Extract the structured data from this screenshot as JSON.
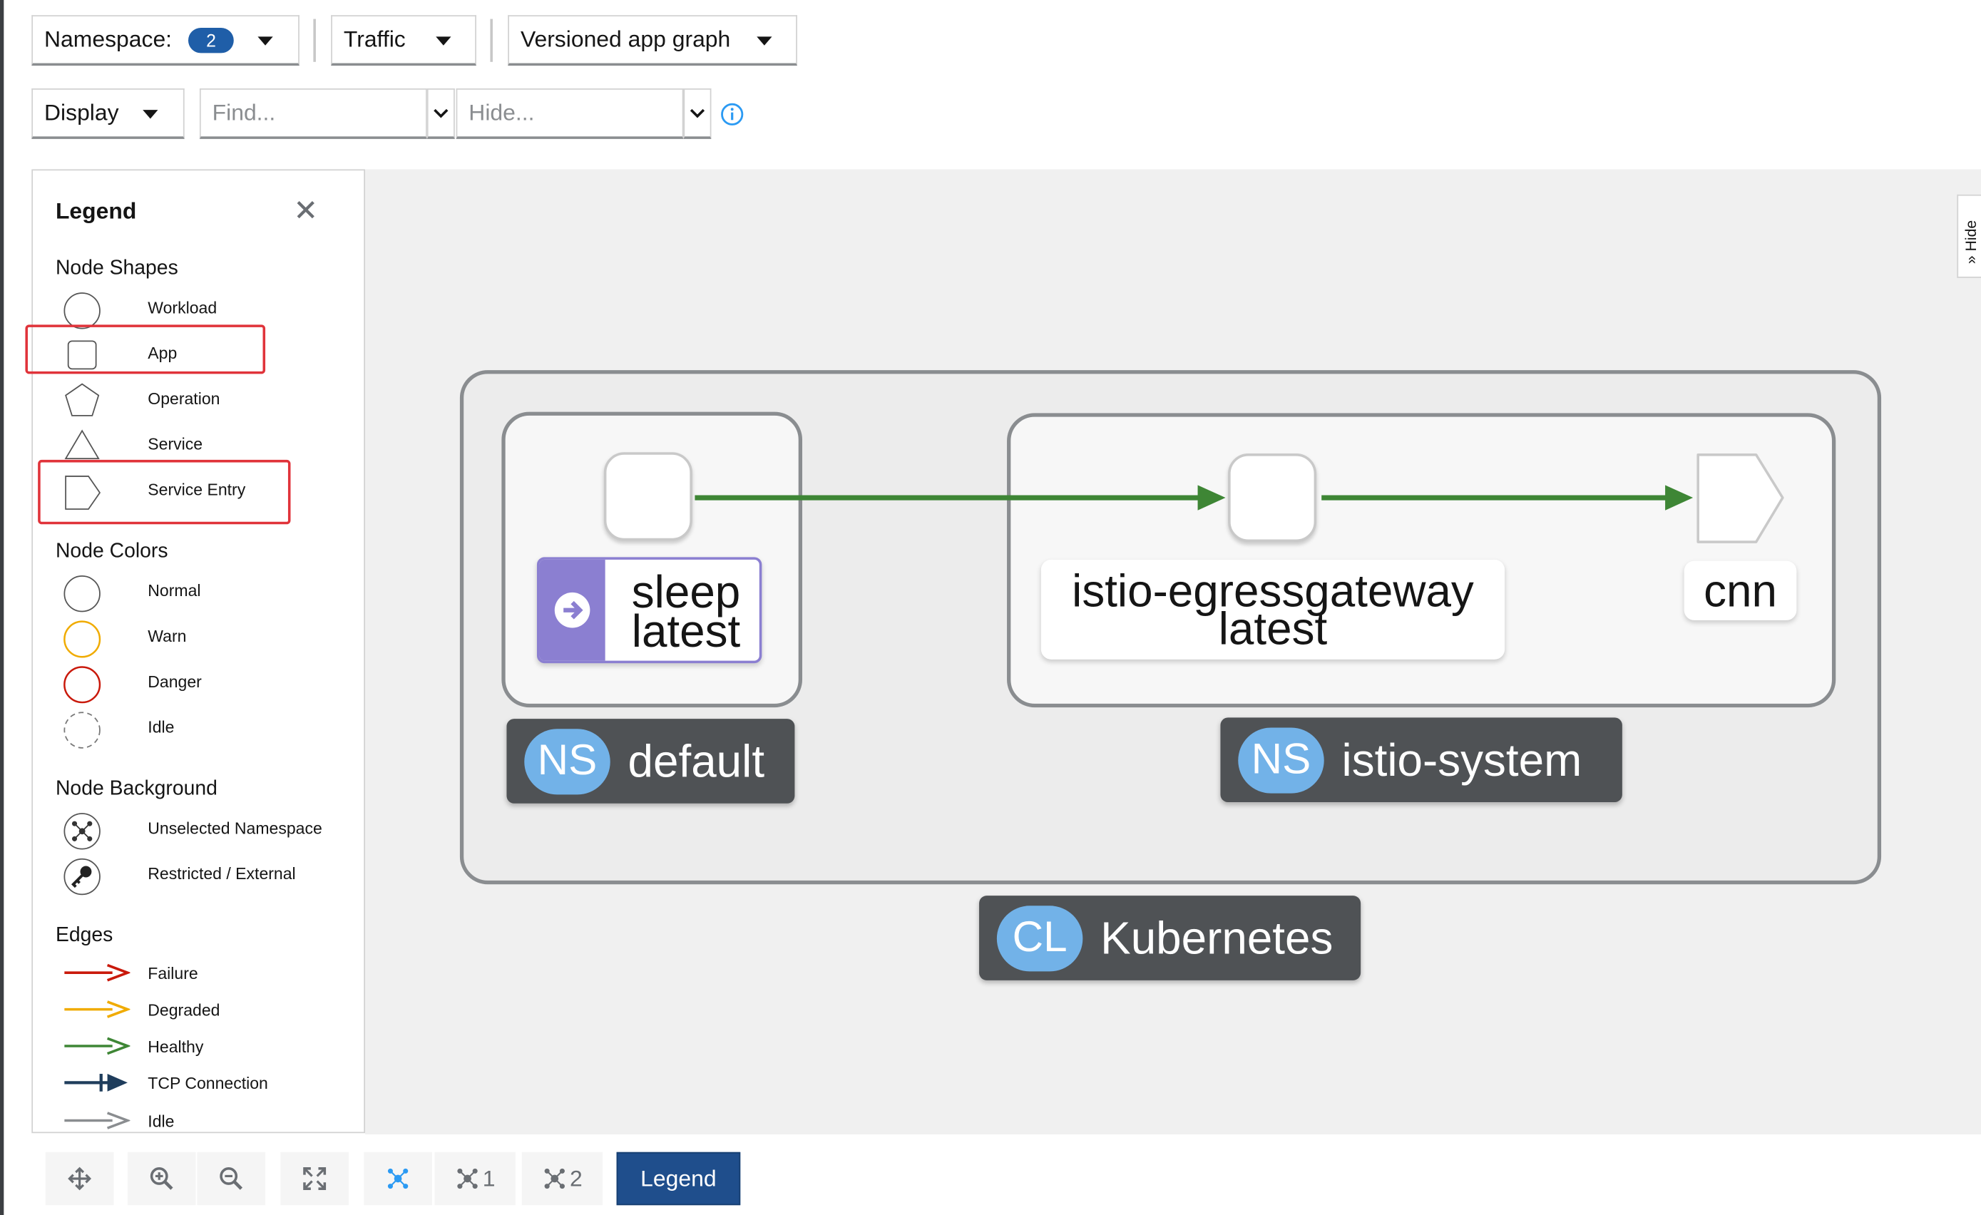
{
  "toolbar": {
    "namespace_label": "Namespace:",
    "namespace_count": "2",
    "traffic_label": "Traffic",
    "graph_type_label": "Versioned app graph",
    "display_label": "Display",
    "find_placeholder": "Find...",
    "hide_placeholder": "Hide..."
  },
  "legend": {
    "title": "Legend",
    "node_shapes": {
      "heading": "Node Shapes",
      "items": [
        "Workload",
        "App",
        "Operation",
        "Service",
        "Service Entry"
      ]
    },
    "node_colors": {
      "heading": "Node Colors",
      "items": [
        "Normal",
        "Warn",
        "Danger",
        "Idle"
      ]
    },
    "node_background": {
      "heading": "Node Background",
      "items": [
        "Unselected Namespace",
        "Restricted / External"
      ]
    },
    "edges": {
      "heading": "Edges",
      "items": [
        "Failure",
        "Degraded",
        "Healthy",
        "TCP Connection",
        "Idle"
      ]
    }
  },
  "graph": {
    "nodes": {
      "sleep": {
        "name": "sleep",
        "version": "latest"
      },
      "egress": {
        "name": "istio-egressgateway",
        "version": "latest"
      },
      "cnn": {
        "name": "cnn"
      }
    },
    "namespaces": {
      "default": {
        "badge": "NS",
        "name": "default"
      },
      "istio_system": {
        "badge": "NS",
        "name": "istio-system"
      }
    },
    "cluster": {
      "badge": "CL",
      "name": "Kubernetes"
    }
  },
  "bottom_toolbar": {
    "layout1_label": "1",
    "layout2_label": "2",
    "legend_button": "Legend"
  },
  "side_tab": {
    "hide_label": "Hide"
  },
  "colors": {
    "failure": "#c9190b",
    "degraded": "#f0ab00",
    "healthy": "#3e8635",
    "tcp": "#1f3d5c",
    "idle": "#8a8d90",
    "accent": "#1f4e8c",
    "namespace_pill": "#72b2e8",
    "highlight_box": "#e0333a"
  }
}
